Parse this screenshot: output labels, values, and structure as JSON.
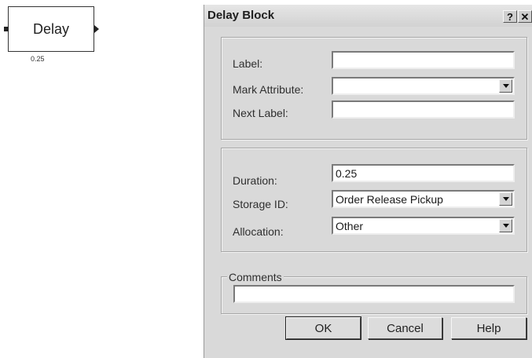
{
  "block": {
    "name": "Delay",
    "value": "0.25"
  },
  "dialog": {
    "title": "Delay Block",
    "help_glyph": "?",
    "close_glyph": "✕",
    "labels_group": {
      "label_label": "Label:",
      "label_value": "",
      "mark_attribute_label": "Mark Attribute:",
      "mark_attribute_value": "",
      "next_label_label": "Next Label:",
      "next_label_value": ""
    },
    "params_group": {
      "duration_label": "Duration:",
      "duration_value": "0.25",
      "storage_id_label": "Storage ID:",
      "storage_id_value": "Order Release Pickup",
      "allocation_label": "Allocation:",
      "allocation_value": "Other"
    },
    "comments": {
      "legend": "Comments",
      "value": ""
    },
    "buttons": {
      "ok": "OK",
      "cancel": "Cancel",
      "help": "Help"
    }
  }
}
